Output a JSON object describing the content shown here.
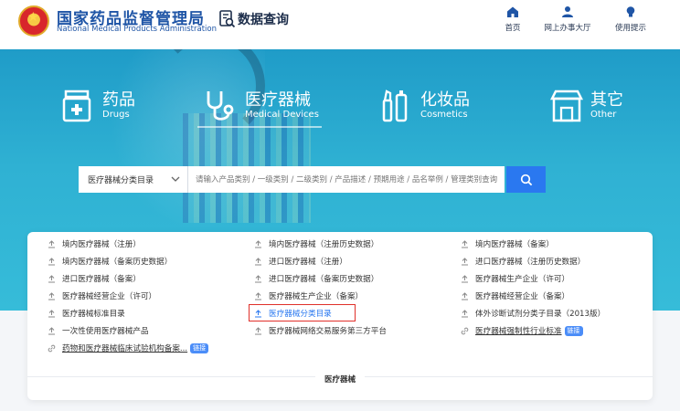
{
  "header": {
    "org_name_cn": "国家药品监督管理局",
    "org_name_en": "National Medical Products Administration",
    "data_query_title": "数据查询",
    "nav": [
      {
        "label": "首页",
        "icon": "home-icon"
      },
      {
        "label": "网上办事大厅",
        "icon": "user-icon"
      },
      {
        "label": "使用提示",
        "icon": "bulb-icon"
      }
    ]
  },
  "categories": [
    {
      "cn": "药品",
      "en": "Drugs",
      "icon": "drug-box-icon"
    },
    {
      "cn": "医疗器械",
      "en": "Medical Devices",
      "icon": "stethoscope-icon",
      "active": true
    },
    {
      "cn": "化妆品",
      "en": "Cosmetics",
      "icon": "cosmetics-icon"
    },
    {
      "cn": "其它",
      "en": "Other",
      "icon": "store-icon"
    }
  ],
  "search": {
    "selected_category": "医疗器械分类目录",
    "placeholder": "请输入产品类别 / 一级类别 / 二级类别 / 产品描述 / 预期用途 / 品名举例 / 管理类别查询"
  },
  "list": {
    "col1": [
      {
        "label": "境内医疗器械（注册）"
      },
      {
        "label": "境内医疗器械（备案历史数据）"
      },
      {
        "label": "进口医疗器械（备案）"
      },
      {
        "label": "医疗器械经营企业（许可）"
      },
      {
        "label": "医疗器械标准目录"
      },
      {
        "label": "一次性使用医疗器械产品"
      },
      {
        "label": "药物和医疗器械临床试验机构备案...",
        "link": true,
        "badge": "链接"
      }
    ],
    "col2": [
      {
        "label": "境内医疗器械（注册历史数据）"
      },
      {
        "label": "进口医疗器械（注册）"
      },
      {
        "label": "进口医疗器械（备案历史数据）"
      },
      {
        "label": "医疗器械生产企业（备案）"
      },
      {
        "label": "医疗器械分类目录",
        "highlight": true
      },
      {
        "label": "医疗器械网络交易服务第三方平台"
      }
    ],
    "col3": [
      {
        "label": "境内医疗器械（备案）"
      },
      {
        "label": "进口医疗器械（注册历史数据）"
      },
      {
        "label": "医疗器械生产企业（许可）"
      },
      {
        "label": "医疗器械经营企业（备案）"
      },
      {
        "label": "体外诊断试剂分类子目录（2013版）"
      },
      {
        "label": "医疗器械强制性行业标准",
        "link": true,
        "badge": "链接"
      }
    ],
    "footer_label": "医疗器械"
  },
  "colors": {
    "brand_blue": "#1f55a6",
    "accent_blue": "#2a78f0",
    "highlight_red": "#e0302a"
  }
}
